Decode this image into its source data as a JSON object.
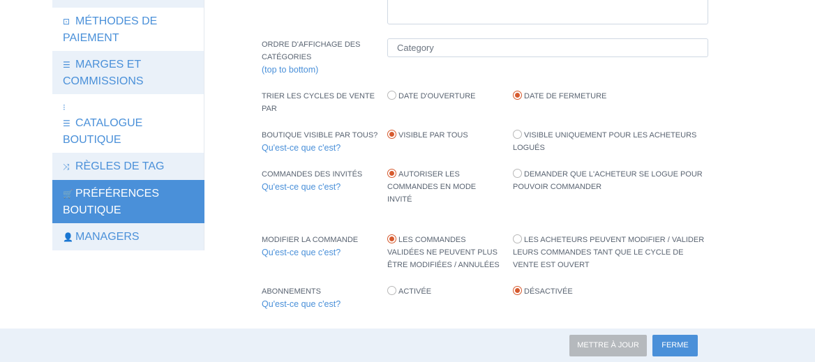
{
  "sidebar": {
    "items": [
      {
        "label": "MÉTHODES DE PAIEMENT",
        "icon": "money-icon",
        "glyph": "⊡"
      },
      {
        "label": "MARGES ET COMMISSIONS",
        "icon": "list-icon",
        "glyph": "☰"
      },
      {
        "label": "CATALOGUE BOUTIQUE",
        "icon": "list-ul-icon",
        "glyph": "⁝☰"
      },
      {
        "label": "RÈGLES DE TAG",
        "icon": "random-icon",
        "glyph": "⤨"
      },
      {
        "label": "PRÉFÉRENCES BOUTIQUE",
        "icon": "cart-icon",
        "glyph": "🛒"
      },
      {
        "label": "MANAGERS",
        "icon": "user-icon",
        "glyph": "👤"
      }
    ]
  },
  "form": {
    "category_order": {
      "label": "ORDRE D'AFFICHAGE DES CATÉGORIES",
      "help": "(top to bottom)",
      "placeholder": "Category"
    },
    "sort_cycles": {
      "label": "TRIER LES CYCLES DE VENTE PAR",
      "opt1": "DATE D'OUVERTURE",
      "opt2": "DATE DE FERMETURE",
      "selected": 2
    },
    "shop_visible": {
      "label": "BOUTIQUE VISIBLE PAR TOUS?",
      "help": "Qu'est-ce que c'est?",
      "opt1": "VISIBLE PAR TOUS",
      "opt2": "VISIBLE UNIQUEMENT POUR LES ACHETEURS LOGUÉS",
      "selected": 1
    },
    "guest_orders": {
      "label": "COMMANDES DES INVITÉS",
      "help": "Qu'est-ce que c'est?",
      "opt1": "AUTORISER LES COMMANDES EN MODE INVITÉ",
      "opt2": "DEMANDER QUE L'ACHETEUR SE LOGUE POUR POUVOIR COMMANDER",
      "selected": 1
    },
    "modify_order": {
      "label": "MODIFIER LA COMMANDE",
      "help": "Qu'est-ce que c'est?",
      "opt1": "LES COMMANDES VALIDÉES NE PEUVENT PLUS ÊTRE MODIFIÉES / ANNULÉES",
      "opt2": "LES ACHETEURS PEUVENT MODIFIER / VALIDER LEURS COMMANDES TANT QUE LE CYCLE DE VENTE EST OUVERT",
      "selected": 1
    },
    "subscriptions": {
      "label": "ABONNEMENTS",
      "help": "Qu'est-ce que c'est?",
      "opt1": "ACTIVÉE",
      "opt2": "DÉSACTIVÉE",
      "selected": 2
    }
  },
  "footer": {
    "update_label": "METTRE À JOUR",
    "close_label": "FERME"
  },
  "colors": {
    "accent": "#4a90d9",
    "radio_selected": "#d65a2e",
    "sidebar_alt_bg": "#eaf1f9",
    "button_disabled": "#b5b9bd"
  }
}
